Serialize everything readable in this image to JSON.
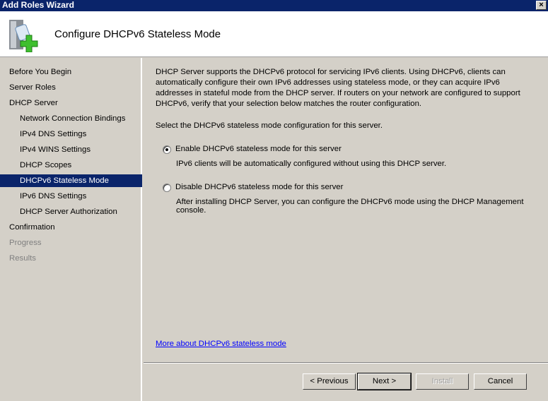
{
  "window": {
    "title": "Add Roles Wizard",
    "close": "×"
  },
  "header": {
    "title": "Configure DHCPv6 Stateless Mode",
    "icon": "server-add-icon"
  },
  "nav": [
    {
      "label": "Before You Begin",
      "level": 0,
      "state": "normal"
    },
    {
      "label": "Server Roles",
      "level": 0,
      "state": "normal"
    },
    {
      "label": "DHCP Server",
      "level": 0,
      "state": "normal"
    },
    {
      "label": "Network Connection Bindings",
      "level": 1,
      "state": "normal"
    },
    {
      "label": "IPv4 DNS Settings",
      "level": 1,
      "state": "normal"
    },
    {
      "label": "IPv4 WINS Settings",
      "level": 1,
      "state": "normal"
    },
    {
      "label": "DHCP Scopes",
      "level": 1,
      "state": "normal"
    },
    {
      "label": "DHCPv6 Stateless Mode",
      "level": 1,
      "state": "selected"
    },
    {
      "label": "IPv6 DNS Settings",
      "level": 1,
      "state": "normal"
    },
    {
      "label": "DHCP Server Authorization",
      "level": 1,
      "state": "normal"
    },
    {
      "label": "Confirmation",
      "level": 0,
      "state": "normal"
    },
    {
      "label": "Progress",
      "level": 0,
      "state": "disabled"
    },
    {
      "label": "Results",
      "level": 0,
      "state": "disabled"
    }
  ],
  "main": {
    "intro": "DHCP Server supports the DHCPv6 protocol for servicing IPv6 clients. Using DHCPv6, clients can automatically configure their own IPv6 addresses using stateless mode, or they can acquire IPv6 addresses in stateful mode from the DHCP server. If routers on your network are configured to support DHCPv6, verify that your selection below matches the router configuration.",
    "prompt": "Select the DHCPv6 stateless mode configuration for this server.",
    "options": [
      {
        "label": "Enable DHCPv6 stateless mode for this server",
        "desc": "IPv6 clients will be automatically configured without using this DHCP server.",
        "checked": true
      },
      {
        "label": "Disable DHCPv6 stateless mode for this server",
        "desc": "After installing DHCP Server, you can configure the DHCPv6 mode using the DHCP Management console.",
        "checked": false
      }
    ],
    "link": "More about DHCPv6 stateless mode"
  },
  "buttons": {
    "previous": "< Previous",
    "next": "Next >",
    "install": "Install",
    "cancel": "Cancel"
  }
}
